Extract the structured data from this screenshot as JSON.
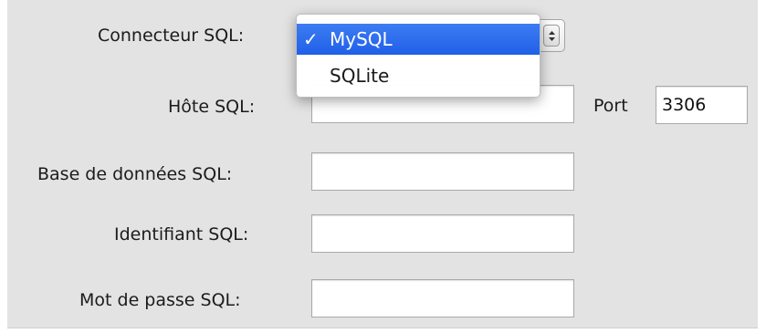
{
  "connector": {
    "label": "Connecteur SQL:",
    "selected_value": "MySQL",
    "check_mark": "✓",
    "options": [
      {
        "label": "MySQL",
        "selected": true
      },
      {
        "label": "SQLite",
        "selected": false
      }
    ]
  },
  "host": {
    "label": "Hôte SQL:",
    "value": ""
  },
  "port": {
    "label": "Port",
    "value": "3306"
  },
  "database": {
    "label": "Base de données SQL:",
    "value": ""
  },
  "username": {
    "label": "Identifiant SQL:",
    "value": ""
  },
  "password": {
    "label": "Mot de passe SQL:",
    "value": ""
  },
  "colors": {
    "panel_background": "#e3e3e3",
    "menu_highlight": "#2d6ff0",
    "field_border": "#a9a9a9"
  },
  "icons": {
    "select_arrows": "updown-chevrons-icon",
    "check": "checkmark-icon"
  }
}
